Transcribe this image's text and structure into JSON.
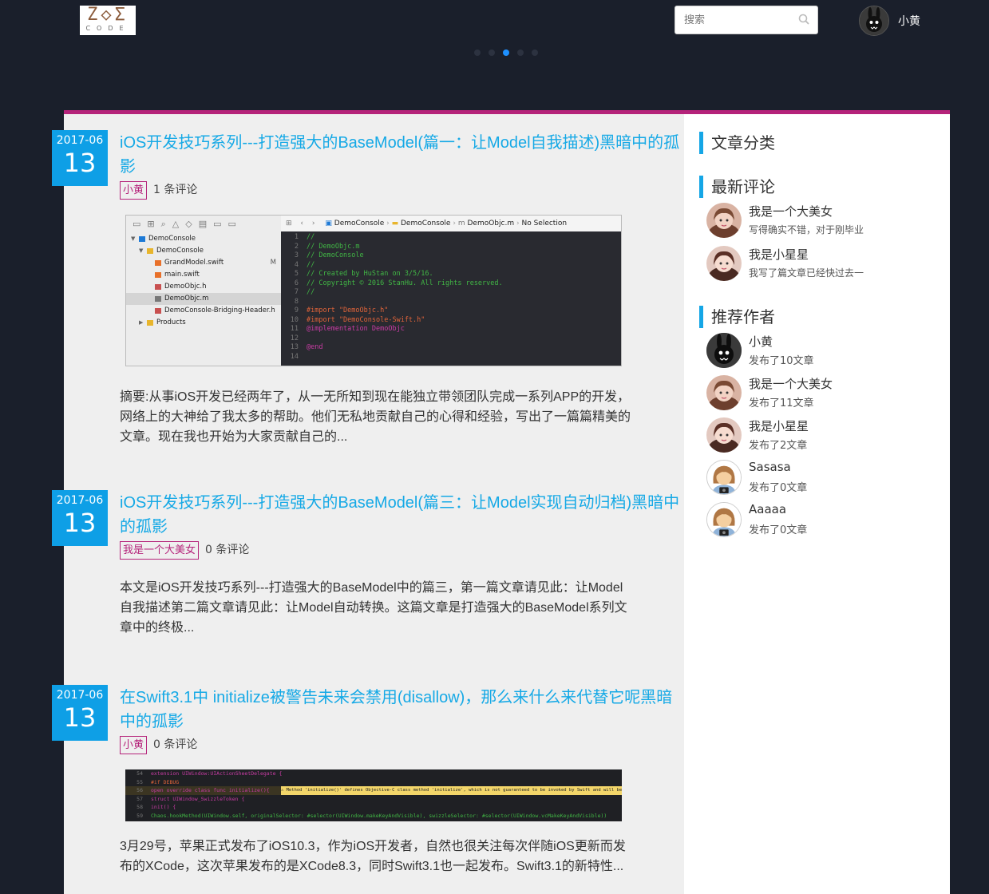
{
  "header": {
    "logo_top": "Z◇Σ",
    "logo_bottom": "CODE",
    "search_placeholder": "搜索",
    "user_name": "小黄",
    "carousel_dots": 5,
    "carousel_active": 3
  },
  "posts": [
    {
      "year_month": "2017-06",
      "day": "13",
      "title": "iOS开发技巧系列---打造强大的BaseModel(篇一：让Model自我描述)黑暗中的孤影",
      "author": "小黄",
      "comments": "1 条评论",
      "excerpt": "摘要:从事iOS开发已经两年了，从一无所知到现在能独立带领团队完成一系列APP的开发，网络上的大神给了我太多的帮助。他们无私地贡献自己的心得和经验，写出了一篇篇精美的文章。现在我也开始为大家贡献自己的..."
    },
    {
      "year_month": "2017-06",
      "day": "13",
      "title": "iOS开发技巧系列---打造强大的BaseModel(篇三：让Model实现自动归档)黑暗中的孤影",
      "author": "我是一个大美女",
      "comments": "0 条评论",
      "excerpt": "本文是iOS开发技巧系列---打造强大的BaseModel中的篇三，第一篇文章请见此：让Model自我描述第二篇文章请见此：让Model自动转换。这篇文章是打造强大的BaseModel系列文章中的终极..."
    },
    {
      "year_month": "2017-06",
      "day": "13",
      "title": "在Swift3.1中 initialize被警告未来会禁用(disallow)，那么来什么来代替它呢黑暗中的孤影",
      "author": "小黄",
      "comments": "0 条评论",
      "excerpt": "3月29号，苹果正式发布了iOS10.3，作为iOS开发者，自然也很关注每次伴随iOS更新而发布的XCode，这次苹果发布的是XCode8.3，同时Swift3.1也一起发布。Swift3.1的新特性..."
    }
  ],
  "xcode1": {
    "crumb_project": "DemoConsole",
    "crumb_group": "DemoConsole",
    "crumb_file": "DemoObjc.m",
    "crumb_sel": "No Selection",
    "tree": [
      {
        "name": "DemoConsole",
        "indent": 0,
        "kind": "project",
        "arrow": "▼"
      },
      {
        "name": "DemoConsole",
        "indent": 1,
        "kind": "folder",
        "arrow": "▼"
      },
      {
        "name": "GrandModel.swift",
        "indent": 2,
        "kind": "swift",
        "badge": "M"
      },
      {
        "name": "main.swift",
        "indent": 2,
        "kind": "swift"
      },
      {
        "name": "DemoObjc.h",
        "indent": 2,
        "kind": "h"
      },
      {
        "name": "DemoObjc.m",
        "indent": 2,
        "kind": "m",
        "selected": true
      },
      {
        "name": "DemoConsole-Bridging-Header.h",
        "indent": 2,
        "kind": "h"
      },
      {
        "name": "Products",
        "indent": 1,
        "kind": "folder",
        "arrow": "▶"
      }
    ],
    "code": [
      {
        "n": "1",
        "t": "//",
        "c": "#41b645"
      },
      {
        "n": "2",
        "t": "//  DemoObjc.m",
        "c": "#41b645"
      },
      {
        "n": "3",
        "t": "//  DemoConsole",
        "c": "#41b645"
      },
      {
        "n": "4",
        "t": "//",
        "c": "#41b645"
      },
      {
        "n": "5",
        "t": "//  Created by HuStan on 3/5/16.",
        "c": "#41b645"
      },
      {
        "n": "6",
        "t": "//  Copyright © 2016 StanHu. All rights reserved.",
        "c": "#41b645"
      },
      {
        "n": "7",
        "t": "//",
        "c": "#41b645"
      },
      {
        "n": "8",
        "t": "",
        "c": "#fff"
      },
      {
        "n": "9",
        "t": "#import \"DemoObjc.h\"",
        "c": "#e0643a"
      },
      {
        "n": "10",
        "t": "#import \"DemoConsole-Swift.h\"",
        "c": "#e0643a"
      },
      {
        "n": "11",
        "t": "@implementation DemoObjc",
        "c": "#c83ca4"
      },
      {
        "n": "12",
        "t": "",
        "c": "#fff"
      },
      {
        "n": "13",
        "t": "@end",
        "c": "#c83ca4"
      },
      {
        "n": "14",
        "t": "",
        "c": "#fff"
      }
    ]
  },
  "xcode2": {
    "code": [
      {
        "n": "54",
        "t": "extension UIWindow:UIActionSheetDelegate {",
        "c": "#c83ca4"
      },
      {
        "n": "55",
        "t": "    #if DEBUG",
        "c": "#e0643a"
      },
      {
        "n": "56",
        "t": "    open override  class func initialize(){",
        "c": "#c83ca4",
        "warn": "Method 'initialize()' defines Objective-C class method 'initialize', which is not guaranteed to be invoked by Swift and will be disallowed in future versions"
      },
      {
        "n": "57",
        "t": "      struct UIWindow_SwizzleToken {",
        "c": "#c83ca4"
      },
      {
        "n": "58",
        "t": "          init() {",
        "c": "#c83ca4"
      },
      {
        "n": "59",
        "t": "              Chaos.hookMethod(UIWindow.self, originalSelector: #selector(UIWindow.makeKeyAndVisible), swizzleSelector: #selector(UIWindow.vcMakeKeyAndVisible))",
        "c": "#41b645"
      }
    ]
  },
  "sidebar": {
    "categories_title": "文章分类",
    "comments_title": "最新评论",
    "authors_title": "推荐作者",
    "comments": [
      {
        "name": "我是一个大美女",
        "text": "写得确实不错，对于刚毕业"
      },
      {
        "name": "我是小星星",
        "text": "我写了篇文章已经快过去一"
      }
    ],
    "authors": [
      {
        "name": "小黄",
        "count": "发布了10文章",
        "avatar": "bunny"
      },
      {
        "name": "我是一个大美女",
        "count": "发布了11文章",
        "avatar": "girl"
      },
      {
        "name": "我是小星星",
        "count": "发布了2文章",
        "avatar": "girl2"
      },
      {
        "name": "Sasasa",
        "count": "发布了0文章",
        "avatar": "cartoon"
      },
      {
        "name": "Aaaaa",
        "count": "发布了0文章",
        "avatar": "cartoon"
      }
    ]
  }
}
